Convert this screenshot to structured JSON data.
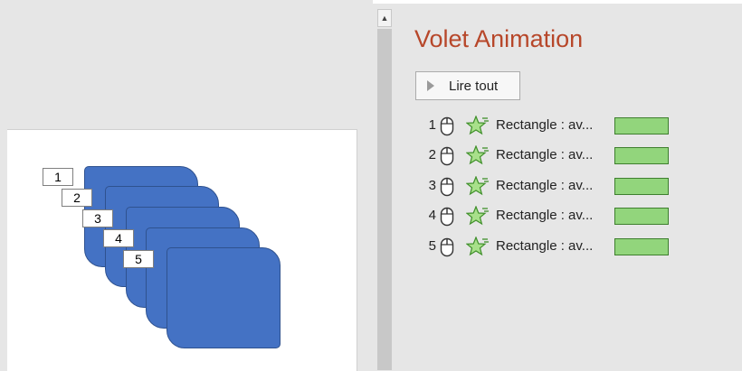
{
  "pane": {
    "title": "Volet Animation",
    "play_button_label": "Lire tout"
  },
  "slide": {
    "order_tags": [
      "1",
      "2",
      "3",
      "4",
      "5"
    ]
  },
  "animations": [
    {
      "order": "1",
      "trigger": "mouse-icon",
      "effect": "star-icon",
      "label": "Rectangle : av...",
      "bar_color": "#92d57c"
    },
    {
      "order": "2",
      "trigger": "mouse-icon",
      "effect": "star-icon",
      "label": "Rectangle : av...",
      "bar_color": "#92d57c"
    },
    {
      "order": "3",
      "trigger": "mouse-icon",
      "effect": "star-icon",
      "label": "Rectangle : av...",
      "bar_color": "#92d57c"
    },
    {
      "order": "4",
      "trigger": "mouse-icon",
      "effect": "star-icon",
      "label": "Rectangle : av...",
      "bar_color": "#92d57c"
    },
    {
      "order": "5",
      "trigger": "mouse-icon",
      "effect": "star-icon",
      "label": "Rectangle : av...",
      "bar_color": "#92d57c"
    }
  ],
  "colors": {
    "title": "#b7472a",
    "shape_fill": "#4472c4",
    "timing_bar": "#92d57c"
  }
}
